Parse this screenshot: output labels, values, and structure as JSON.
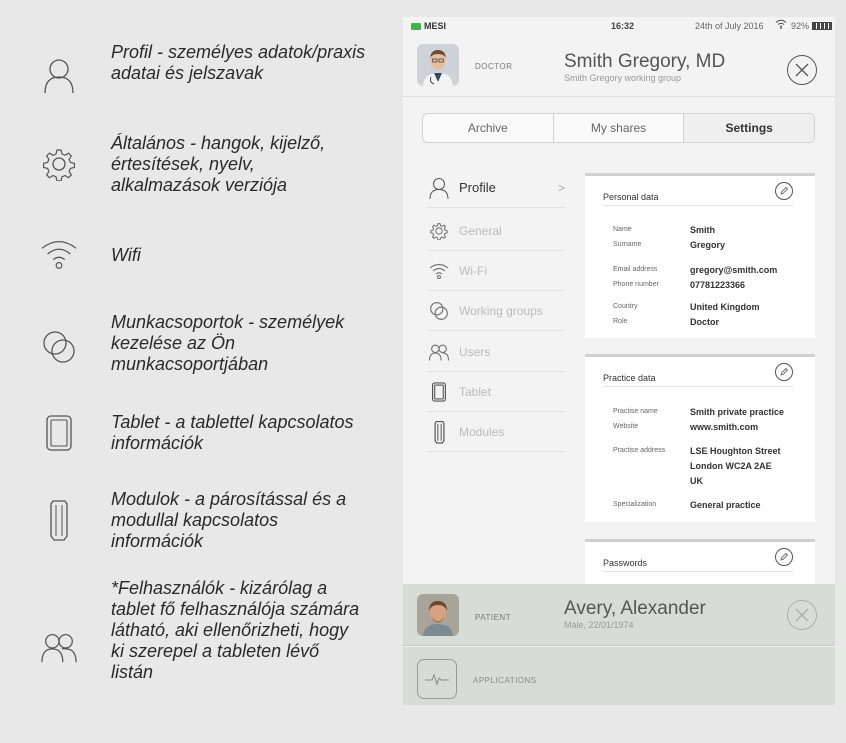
{
  "legend": [
    {
      "icon": "user-outline-icon",
      "text": "Profil - személyes adatok/praxis adatai és jelszavak"
    },
    {
      "icon": "gear-icon",
      "text": "Általános - hangok, kijelző, értesítések, nyelv, alkalmazások verziója"
    },
    {
      "icon": "wifi-icon",
      "text": "Wifi"
    },
    {
      "icon": "working-groups-icon",
      "text": "Munkacsoportok - személyek kezelése az Ön munkacsoportjában"
    },
    {
      "icon": "tablet-icon",
      "text": "Tablet - a tablettel kapcsolatos információk"
    },
    {
      "icon": "module-icon",
      "text": "Modulok - a párosítással és a modullal kapcsolatos információk"
    },
    {
      "icon": "users-icon",
      "text": "*Felhasználók - kizárólag a tablet fő felhasználója számára látható, aki ellenőrizheti, hogy ki szerepel a tableten lévő listán"
    }
  ],
  "status": {
    "brand": "MESI",
    "time": "16:32",
    "date": "24th of July 2016",
    "battery": "92%"
  },
  "doctor": {
    "role": "DOCTOR",
    "name": "Smith Gregory, MD",
    "group": "Smith Gregory working group"
  },
  "tabs": [
    "Archive",
    "My shares",
    "Settings"
  ],
  "sidebar": [
    {
      "icon": "user-outline-icon",
      "label": "Profile",
      "active": true
    },
    {
      "icon": "gear-icon",
      "label": "General"
    },
    {
      "icon": "wifi-icon",
      "label": "Wi-Fi"
    },
    {
      "icon": "working-groups-icon",
      "label": "Working groups"
    },
    {
      "icon": "users-icon",
      "label": "Users"
    },
    {
      "icon": "tablet-icon",
      "label": "Tablet"
    },
    {
      "icon": "module-icon",
      "label": "Modules"
    }
  ],
  "personal": {
    "title": "Personal data",
    "rows": [
      {
        "k": "Name",
        "v": "Smith"
      },
      {
        "k": "Surname",
        "v": "Gregory"
      },
      {
        "k": "Email address",
        "v": "gregory@smith.com"
      },
      {
        "k": "Phone number",
        "v": "07781223366"
      },
      {
        "k": "Country",
        "v": "United Kingdom"
      },
      {
        "k": "Role",
        "v": "Doctor"
      }
    ]
  },
  "practice": {
    "title": "Practice data",
    "rows": [
      {
        "k": "Practise name",
        "v": "Smith private practice"
      },
      {
        "k": "Website",
        "v": "www.smith.com"
      },
      {
        "k": "Practise address",
        "v": "LSE Houghton Street"
      },
      {
        "k": "",
        "v": "London WC2A 2AE"
      },
      {
        "k": "",
        "v": "UK"
      },
      {
        "k": "Specialization",
        "v": "General practice"
      }
    ]
  },
  "passwords": {
    "title": "Passwords"
  },
  "patient": {
    "role": "PATIENT",
    "name": "Avery, Alexander",
    "info": "Male, 22/01/1974"
  },
  "apps": {
    "label": "APPLICATIONS"
  }
}
